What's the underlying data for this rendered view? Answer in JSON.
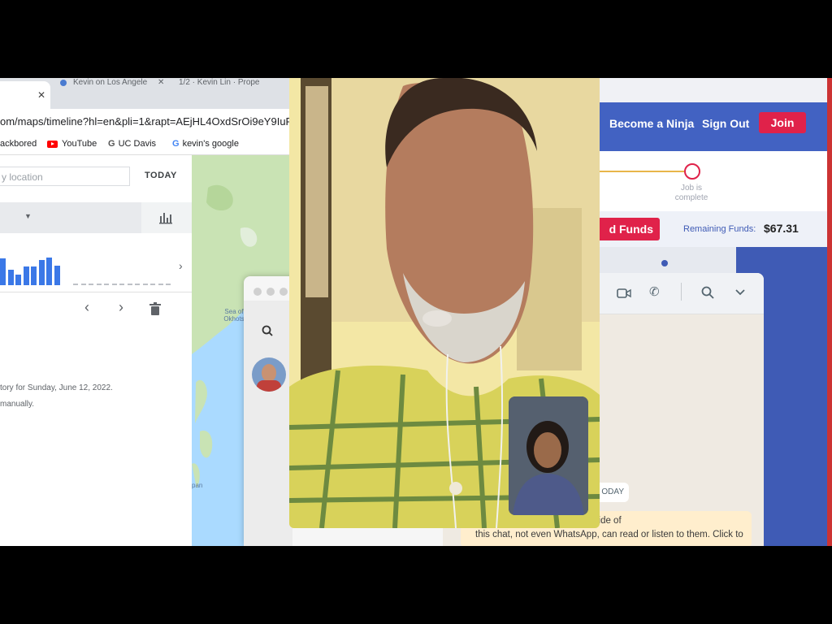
{
  "browser": {
    "tabs": [
      {
        "label": ""
      },
      {
        "label": "Kevin on Los Angele"
      },
      {
        "label": "1/2 · Kevin Lin · Prope"
      }
    ],
    "url": "om/maps/timeline?hl=en&pli=1&rapt=AEjHL4OxdSrOi9eY9IuPj",
    "bookmarks": [
      {
        "label": "ackbored",
        "icon": "bookmark-icon"
      },
      {
        "label": "YouTube",
        "icon": "youtube-icon"
      },
      {
        "label": "UC Davis",
        "icon": "chrome-icon"
      },
      {
        "label": "kevin's google",
        "icon": "google-icon"
      }
    ]
  },
  "timeline": {
    "search_placeholder": "y location",
    "today_label": "TODAY",
    "history_text": "tory for Sunday, June 12, 2022.",
    "manual_text": "manually.",
    "bar_values": [
      0.55,
      0.32,
      0.22,
      0.38,
      0.39,
      0.51,
      0.56,
      0.4
    ],
    "bar_color": "#3b78e7"
  },
  "map": {
    "labels": [
      "Sea of Okhots",
      "pan"
    ]
  },
  "site": {
    "nav": {
      "become": "Become a Ninja",
      "signout": "Sign Out",
      "join": "Join"
    },
    "progress_label": "Job is complete",
    "funds_button": "d Funds",
    "remaining_label": "Remaining Funds:",
    "remaining_value": "$67.31",
    "accent": "#e0224a",
    "blue": "#3f5bb5"
  },
  "whatsapp": {
    "date_pill": "ODAY",
    "encryption_line1": "o-end encrypted. No one outside of",
    "encryption_line2": "this chat, not even WhatsApp, can read or listen to them. Click to"
  }
}
